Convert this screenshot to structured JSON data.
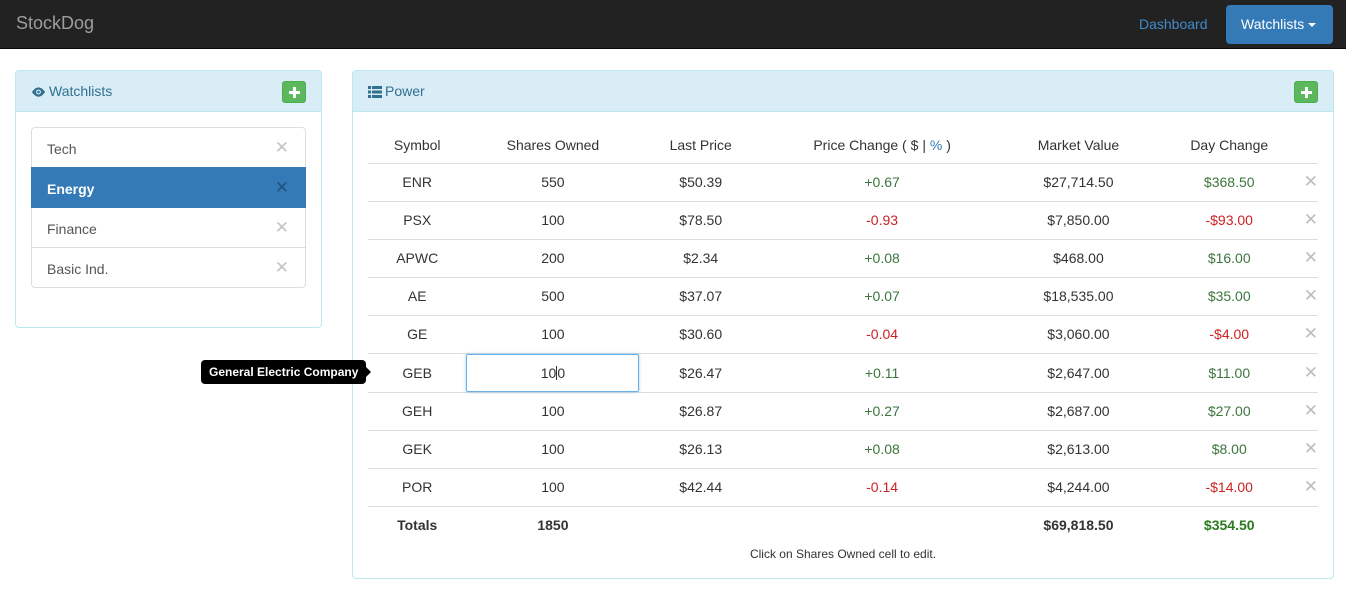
{
  "navbar": {
    "brand": "StockDog",
    "dashboard_link": "Dashboard",
    "watchlists_button": "Watchlists"
  },
  "watchlists_panel": {
    "title": "Watchlists",
    "items": [
      {
        "label": "Tech",
        "active": false
      },
      {
        "label": "Energy",
        "active": true
      },
      {
        "label": "Finance",
        "active": false
      },
      {
        "label": "Basic Ind.",
        "active": false
      }
    ]
  },
  "stocks_panel": {
    "title": "Power",
    "columns": {
      "symbol": "Symbol",
      "shares": "Shares Owned",
      "last_price": "Last Price",
      "price_change_prefix": "Price Change (",
      "price_change_dollar": "$",
      "price_change_sep": "|",
      "price_change_pct": "%",
      "price_change_suffix": ")",
      "market_value": "Market Value",
      "day_change": "Day Change"
    },
    "rows": [
      {
        "symbol": "ENR",
        "shares": "550",
        "last_price": "$50.39",
        "price_change": "+0.67",
        "market_value": "$27,714.50",
        "day_change": "$368.50"
      },
      {
        "symbol": "PSX",
        "shares": "100",
        "last_price": "$78.50",
        "price_change": "-0.93",
        "market_value": "$7,850.00",
        "day_change": "-$93.00"
      },
      {
        "symbol": "APWC",
        "shares": "200",
        "last_price": "$2.34",
        "price_change": "+0.08",
        "market_value": "$468.00",
        "day_change": "$16.00"
      },
      {
        "symbol": "AE",
        "shares": "500",
        "last_price": "$37.07",
        "price_change": "+0.07",
        "market_value": "$18,535.00",
        "day_change": "$35.00"
      },
      {
        "symbol": "GE",
        "shares": "100",
        "last_price": "$30.60",
        "price_change": "-0.04",
        "market_value": "$3,060.00",
        "day_change": "-$4.00"
      },
      {
        "symbol": "GEB",
        "shares_before_cursor": "10",
        "shares_after_cursor": "0",
        "last_price": "$26.47",
        "price_change": "+0.11",
        "market_value": "$2,647.00",
        "day_change": "$11.00"
      },
      {
        "symbol": "GEH",
        "shares": "100",
        "last_price": "$26.87",
        "price_change": "+0.27",
        "market_value": "$2,687.00",
        "day_change": "$27.00"
      },
      {
        "symbol": "GEK",
        "shares": "100",
        "last_price": "$26.13",
        "price_change": "+0.08",
        "market_value": "$2,613.00",
        "day_change": "$8.00"
      },
      {
        "symbol": "POR",
        "shares": "100",
        "last_price": "$42.44",
        "price_change": "-0.14",
        "market_value": "$4,244.00",
        "day_change": "-$14.00"
      }
    ],
    "totals": {
      "label": "Totals",
      "shares": "1850",
      "market_value": "$69,818.50",
      "day_change": "$354.50"
    },
    "hint": "Click on Shares Owned cell to edit."
  },
  "tooltip": {
    "text": "General Electric Company"
  },
  "colors": {
    "navbar_bg": "#222222",
    "primary": "#337ab7",
    "panel_heading_bg": "#d9edf7",
    "positive": "#3c763d",
    "negative": "#cc2222",
    "add_button": "#5cb85c"
  },
  "icons": {
    "watchlists_panel": "eye-icon",
    "stocks_panel": "list-icon",
    "add": "plus-icon",
    "remove": "close-icon",
    "dropdown": "caret-down-icon"
  }
}
